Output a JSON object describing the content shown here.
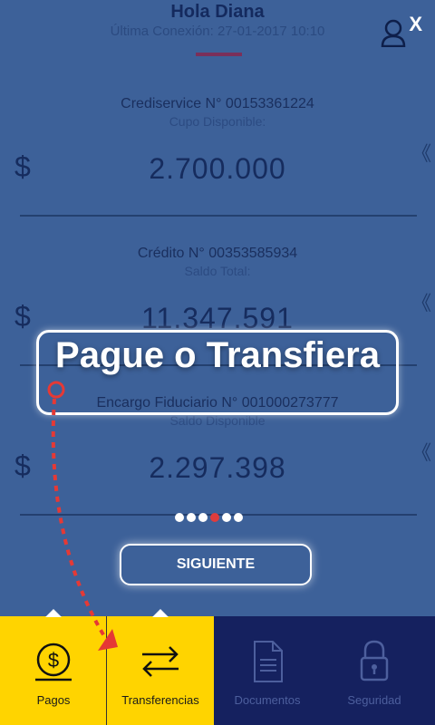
{
  "header": {
    "greeting": "Hola Diana",
    "last_connection": "Última Conexión: 27-01-2017 10:10",
    "close_label": "X"
  },
  "accounts": [
    {
      "name": "Crediservice N° 00153361224",
      "sub": "Cupo Disponible:",
      "currency": "$",
      "amount": "2.700.000"
    },
    {
      "name": "Crédito N° 00353585934",
      "sub": "Saldo Total:",
      "currency": "$",
      "amount": "11.347.591"
    },
    {
      "name": "Encargo Fiduciario N° 001000273777",
      "sub": "Saldo Disponible",
      "currency": "$",
      "amount": "2.297.398"
    }
  ],
  "chevron": "《",
  "onboarding": {
    "title": "Pague o Transfiera",
    "next_label": "SIGUIENTE",
    "total_dots": 6,
    "active_dot": 3
  },
  "nav": [
    {
      "label": "Pagos",
      "icon": "pay-icon"
    },
    {
      "label": "Transferencias",
      "icon": "transfer-icon"
    },
    {
      "label": "Documentos",
      "icon": "document-icon"
    },
    {
      "label": "Seguridad",
      "icon": "lock-icon"
    }
  ],
  "colors": {
    "accent_yellow": "#ffd400",
    "nav_dark": "#15215f",
    "overlay_blue": "#3d6199",
    "arrow_red": "#e53935"
  }
}
